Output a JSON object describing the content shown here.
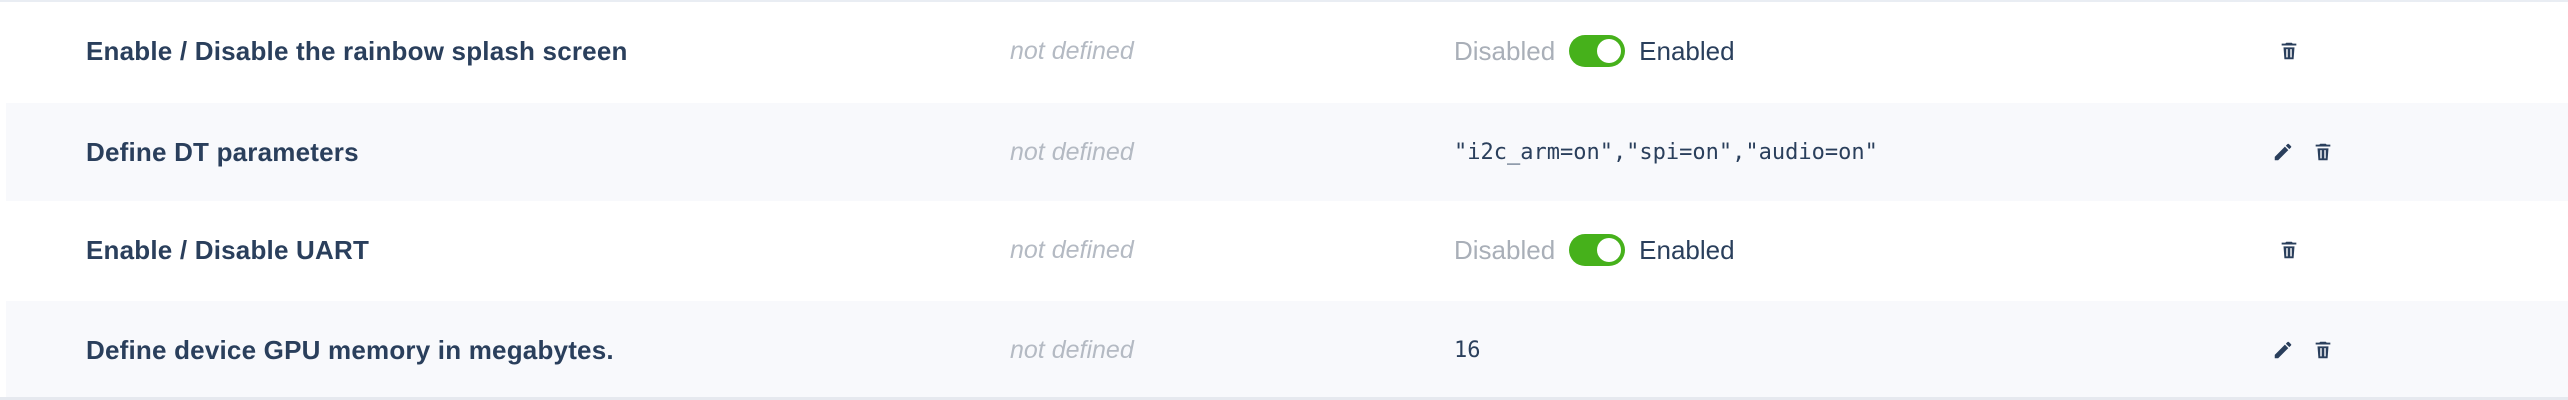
{
  "colors": {
    "text": "#2a3f5c",
    "muted": "#b4bac3",
    "toggle_on": "#46b11b",
    "row_alt": "#f8f9fc"
  },
  "rows": [
    {
      "name": "Enable / Disable the rainbow splash screen",
      "default": "not defined",
      "value_type": "toggle",
      "toggle": {
        "off_label": "Disabled",
        "on_label": "Enabled",
        "state": "on"
      },
      "actions": [
        "delete"
      ]
    },
    {
      "name": "Define DT parameters",
      "default": "not defined",
      "value_type": "text",
      "value": "\"i2c_arm=on\",\"spi=on\",\"audio=on\"",
      "actions": [
        "edit",
        "delete"
      ]
    },
    {
      "name": "Enable / Disable UART",
      "default": "not defined",
      "value_type": "toggle",
      "toggle": {
        "off_label": "Disabled",
        "on_label": "Enabled",
        "state": "on"
      },
      "actions": [
        "delete"
      ]
    },
    {
      "name": "Define device GPU memory in megabytes.",
      "default": "not defined",
      "value_type": "text",
      "value": "16",
      "actions": [
        "edit",
        "delete"
      ]
    }
  ],
  "icons": {
    "edit": "pencil-icon",
    "delete": "trash-icon"
  }
}
